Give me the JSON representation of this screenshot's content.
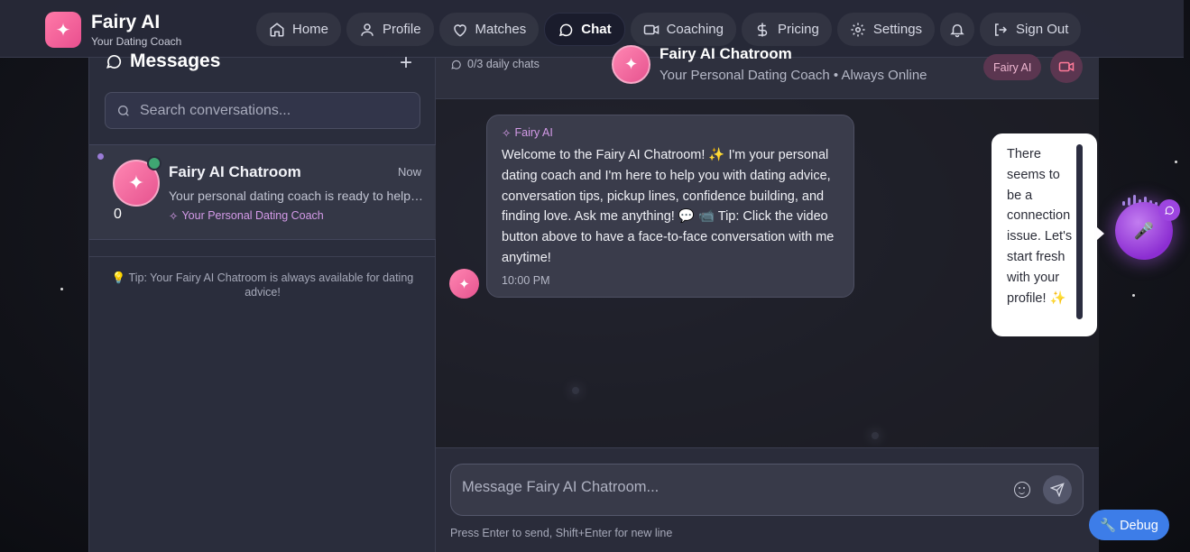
{
  "brand": {
    "title": "Fairy AI",
    "subtitle": "Your Dating Coach"
  },
  "nav": {
    "items": [
      {
        "label": "Home",
        "icon": "home-icon"
      },
      {
        "label": "Profile",
        "icon": "user-icon"
      },
      {
        "label": "Matches",
        "icon": "heart-icon"
      },
      {
        "label": "Chat",
        "icon": "chat-icon",
        "active": true
      },
      {
        "label": "Coaching",
        "icon": "video-icon"
      },
      {
        "label": "Pricing",
        "icon": "dollar-icon"
      },
      {
        "label": "Settings",
        "icon": "gear-icon"
      },
      {
        "label": "Sign Out",
        "icon": "sign-out-icon"
      }
    ],
    "bell_icon": "bell-icon"
  },
  "messages": {
    "title": "Messages",
    "search_placeholder": "Search conversations...",
    "conversation": {
      "name": "Fairy AI Chatroom",
      "time": "Now",
      "preview": "Your personal dating coach is ready to help you with dating advice!",
      "tag": "Your Personal Dating Coach",
      "count": "0"
    },
    "tip": "💡 Tip: Your Fairy AI Chatroom is always available for dating advice!"
  },
  "chat": {
    "daily_chats": "0/3 daily chats",
    "header_name": "Fairy AI Chatroom",
    "header_status": "Your Personal Dating Coach • Always Online",
    "badge": "Fairy AI",
    "message": {
      "sender": "Fairy AI",
      "text": "Welcome to the Fairy AI Chatroom! ✨ I'm your personal dating coach and I'm here to help you with dating advice, conversation tips, pickup lines, confidence building, and finding love. Ask me anything! 💬 📹 Tip: Click the video button above to have a face-to-face conversation with me anytime!",
      "time": "10:00 PM"
    },
    "composer_placeholder": "Message Fairy AI Chatroom...",
    "composer_hint": "Press Enter to send, Shift+Enter for new line"
  },
  "tooltip": {
    "text": "There seems to be a connection issue. Let's start fresh with your profile! ✨"
  },
  "voice_orb": {
    "icon": "microphone-icon"
  },
  "debug": {
    "label": "🔧 Debug"
  },
  "colors": {
    "accent_pink": "#e94f8f",
    "purple": "#9d45e0",
    "debug_blue": "#3d7de8"
  }
}
